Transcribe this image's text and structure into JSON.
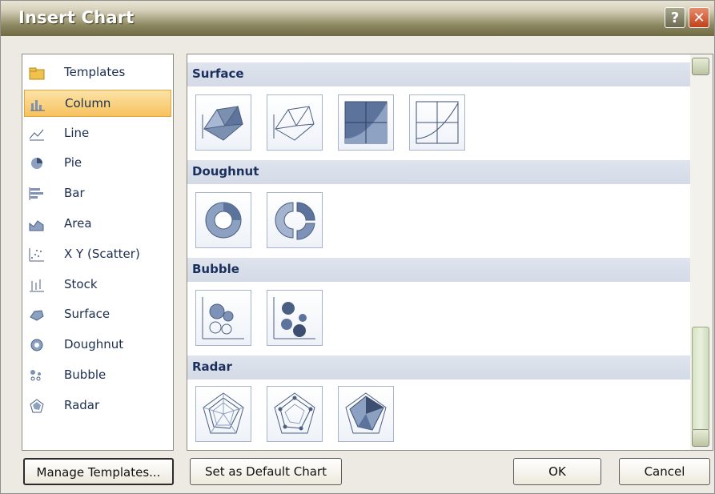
{
  "window": {
    "title": "Insert Chart",
    "help_glyph": "?",
    "close_glyph": "✕"
  },
  "categories": [
    {
      "label": "Templates",
      "icon": "folder-icon",
      "selected": false
    },
    {
      "label": "Column",
      "icon": "column-chart-icon",
      "selected": true
    },
    {
      "label": "Line",
      "icon": "line-chart-icon",
      "selected": false
    },
    {
      "label": "Pie",
      "icon": "pie-chart-icon",
      "selected": false
    },
    {
      "label": "Bar",
      "icon": "bar-chart-icon",
      "selected": false
    },
    {
      "label": "Area",
      "icon": "area-chart-icon",
      "selected": false
    },
    {
      "label": "X Y (Scatter)",
      "icon": "scatter-chart-icon",
      "selected": false
    },
    {
      "label": "Stock",
      "icon": "stock-chart-icon",
      "selected": false
    },
    {
      "label": "Surface",
      "icon": "surface-chart-icon",
      "selected": false
    },
    {
      "label": "Doughnut",
      "icon": "doughnut-chart-icon",
      "selected": false
    },
    {
      "label": "Bubble",
      "icon": "bubble-chart-icon",
      "selected": false
    },
    {
      "label": "Radar",
      "icon": "radar-chart-icon",
      "selected": false
    }
  ],
  "gallery": {
    "surface": {
      "title": "Surface",
      "subtypes": [
        "3d-surface-icon",
        "wireframe-3d-surface-icon",
        "contour-icon",
        "wireframe-contour-icon"
      ]
    },
    "doughnut": {
      "title": "Doughnut",
      "subtypes": [
        "doughnut-icon",
        "exploded-doughnut-icon"
      ]
    },
    "bubble": {
      "title": "Bubble",
      "subtypes": [
        "bubble-icon",
        "3d-bubble-icon"
      ]
    },
    "radar": {
      "title": "Radar",
      "subtypes": [
        "radar-icon",
        "radar-with-markers-icon",
        "filled-radar-icon"
      ]
    }
  },
  "buttons": {
    "manage_templates": "Manage Templates...",
    "set_default": "Set as Default Chart",
    "ok": "OK",
    "cancel": "Cancel"
  },
  "colors": {
    "selection": "#f7c25f",
    "section_header": "#d9dfea",
    "title_text": "#ffffff"
  }
}
